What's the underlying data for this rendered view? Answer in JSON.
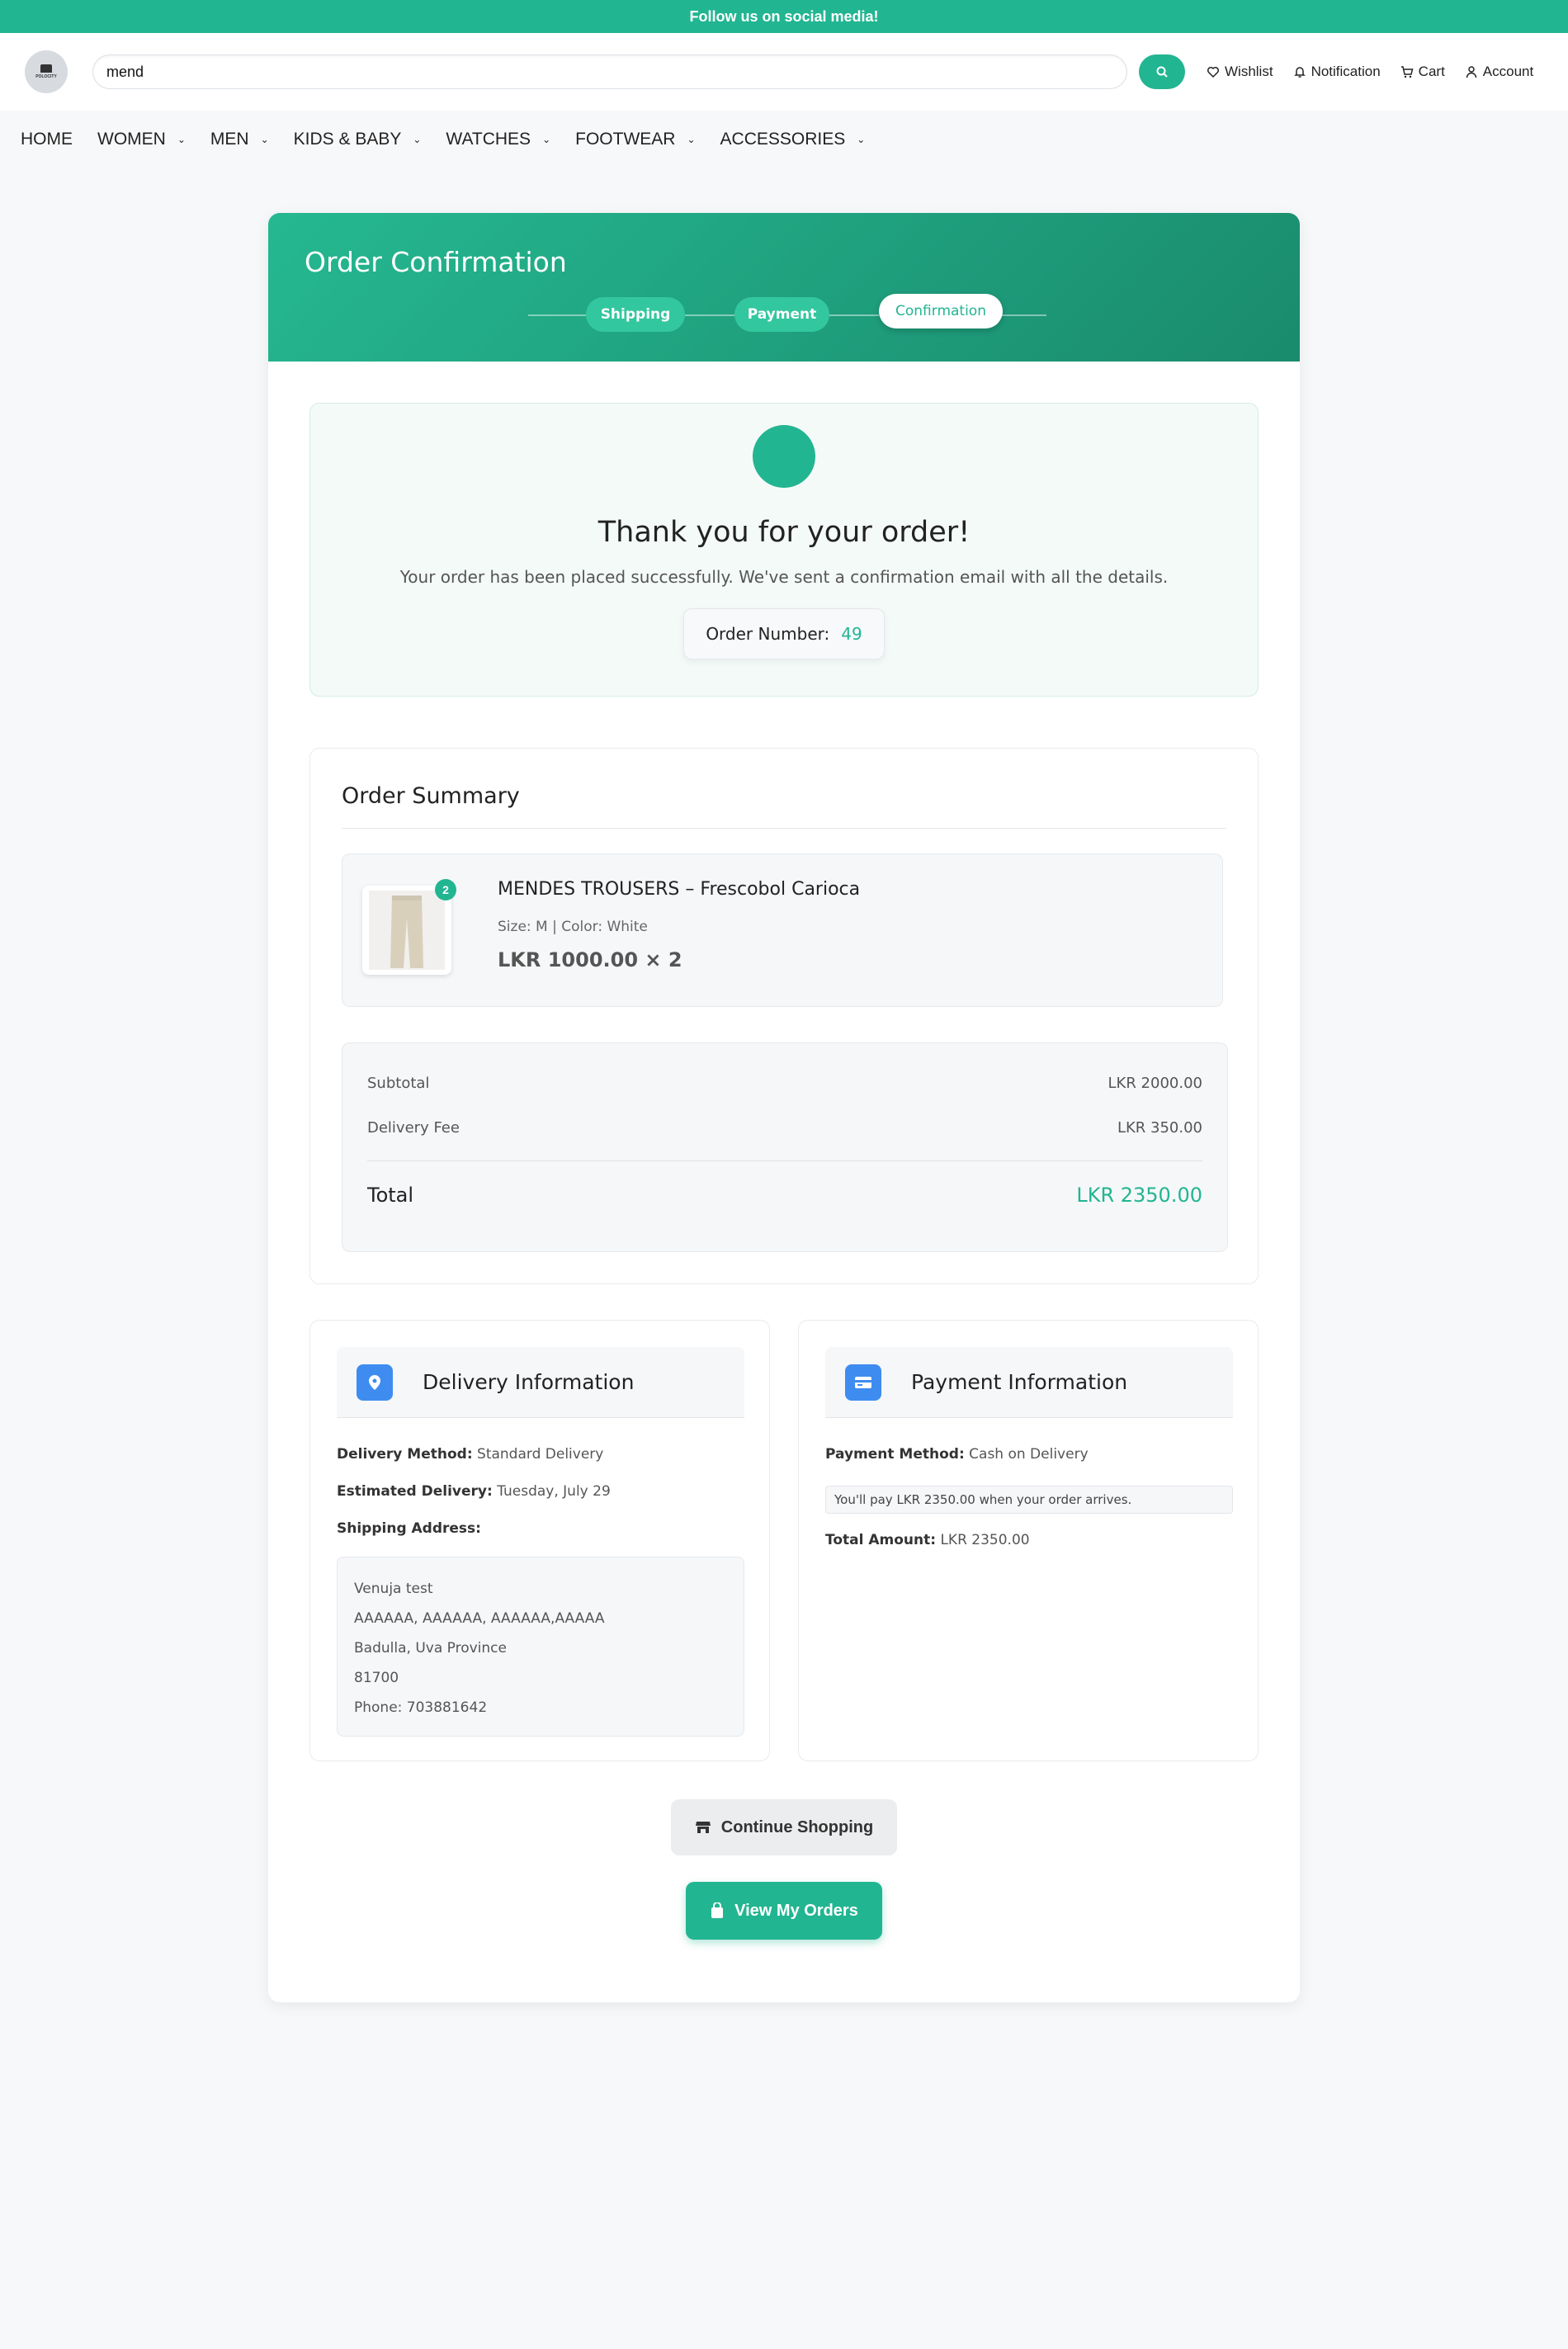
{
  "topbar": {
    "text": "Follow us on social media!"
  },
  "header": {
    "logo_text": "POLOCITY",
    "search_value": "mend",
    "links": [
      {
        "label": "Wishlist",
        "icon": "heart-icon"
      },
      {
        "label": "Notification",
        "icon": "bell-icon"
      },
      {
        "label": "Cart",
        "icon": "cart-icon"
      },
      {
        "label": "Account",
        "icon": "user-icon"
      }
    ]
  },
  "nav": {
    "home": "HOME",
    "women": "WOMEN",
    "men": "MEN",
    "kids": "KIDS & BABY",
    "watches": "WATCHES",
    "footwear": "FOOTWEAR",
    "accessories": "ACCESSORIES"
  },
  "checkout": {
    "title": "Order Confirmation",
    "steps": {
      "shipping": "Shipping",
      "payment": "Payment",
      "confirmation": "Confirmation"
    },
    "active_step": "Confirmation"
  },
  "thanks": {
    "heading": "Thank you for your order!",
    "message": "Your order has been placed successfully. We've sent a confirmation email with all the details.",
    "order_label": "Order Number:",
    "order_number": "49"
  },
  "summary": {
    "title": "Order Summary",
    "item": {
      "name": "MENDES TROUSERS – Frescobol Carioca",
      "attrs": "Size: M | Color: White",
      "price": "LKR 1000.00 × 2",
      "qty_badge": "2"
    },
    "subtotal_label": "Subtotal",
    "subtotal_value": "LKR 2000.00",
    "delivery_label": "Delivery Fee",
    "delivery_value": "LKR 350.00",
    "total_label": "Total",
    "total_value": "LKR 2350.00"
  },
  "delivery": {
    "title": "Delivery Information",
    "method_label": "Delivery Method:",
    "method_value": "Standard Delivery",
    "est_label": "Estimated Delivery:",
    "est_value": "Tuesday, July 29",
    "address_label": "Shipping Address:",
    "address": {
      "name": "Venuja test",
      "street": "AAAAAA, AAAAAA, AAAAAA,AAAAA",
      "city": "Badulla, Uva Province",
      "zip": "81700",
      "phone": "Phone: 703881642"
    }
  },
  "payment": {
    "title": "Payment Information",
    "method_label": "Payment Method:",
    "method_value": "Cash on Delivery",
    "note": "You'll pay LKR 2350.00 when your order arrives.",
    "amount_label": "Total Amount:",
    "amount_value": "LKR 2350.00"
  },
  "actions": {
    "continue": "Continue Shopping",
    "orders": "View My Orders"
  },
  "colors": {
    "brand": "#22b591",
    "info_icon": "#3e8cf0"
  }
}
